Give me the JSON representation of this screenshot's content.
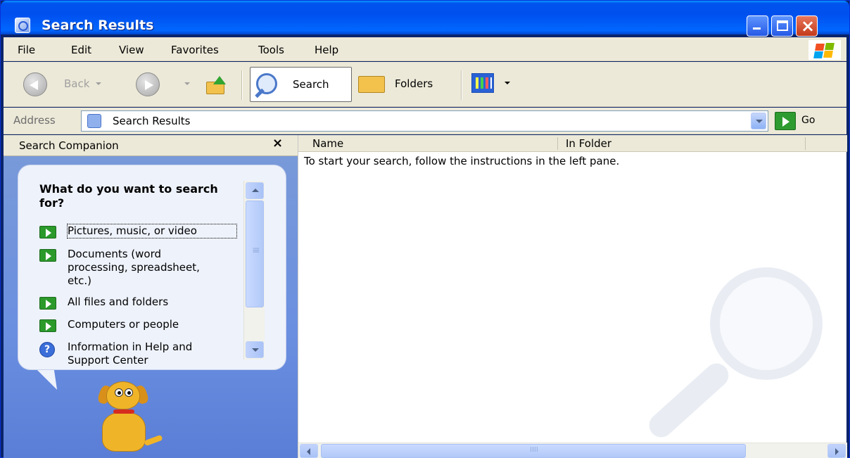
{
  "window": {
    "title": "Search Results"
  },
  "menu": {
    "items": [
      {
        "label": "File"
      },
      {
        "label": "Edit"
      },
      {
        "label": "View"
      },
      {
        "label": "Favorites"
      },
      {
        "label": "Tools"
      },
      {
        "label": "Help"
      }
    ]
  },
  "toolbar": {
    "back_label": "Back",
    "search_label": "Search",
    "folders_label": "Folders"
  },
  "address": {
    "label": "Address",
    "value": "Search Results",
    "go_label": "Go"
  },
  "left_pane": {
    "title": "Search Companion",
    "close_glyph": "×",
    "question": "What do you want to search for?",
    "options": [
      {
        "label": "Pictures, music, or video",
        "icon": "green-arrow-icon"
      },
      {
        "label": "Documents (word processing, spreadsheet, etc.)",
        "icon": "green-arrow-icon"
      },
      {
        "label": "All files and folders",
        "icon": "green-arrow-icon"
      },
      {
        "label": "Computers or people",
        "icon": "green-arrow-icon"
      },
      {
        "label": "Information in Help and Support Center",
        "icon": "help-icon"
      }
    ]
  },
  "results": {
    "columns": [
      {
        "label": "Name"
      },
      {
        "label": "In Folder"
      }
    ],
    "hint": "To start your search, follow the instructions in the left pane."
  },
  "colors": {
    "titlebar": "#0053ee",
    "chrome": "#ece9d8",
    "left_pane": "#6b8fe0",
    "accent_green": "#2e9b30"
  }
}
